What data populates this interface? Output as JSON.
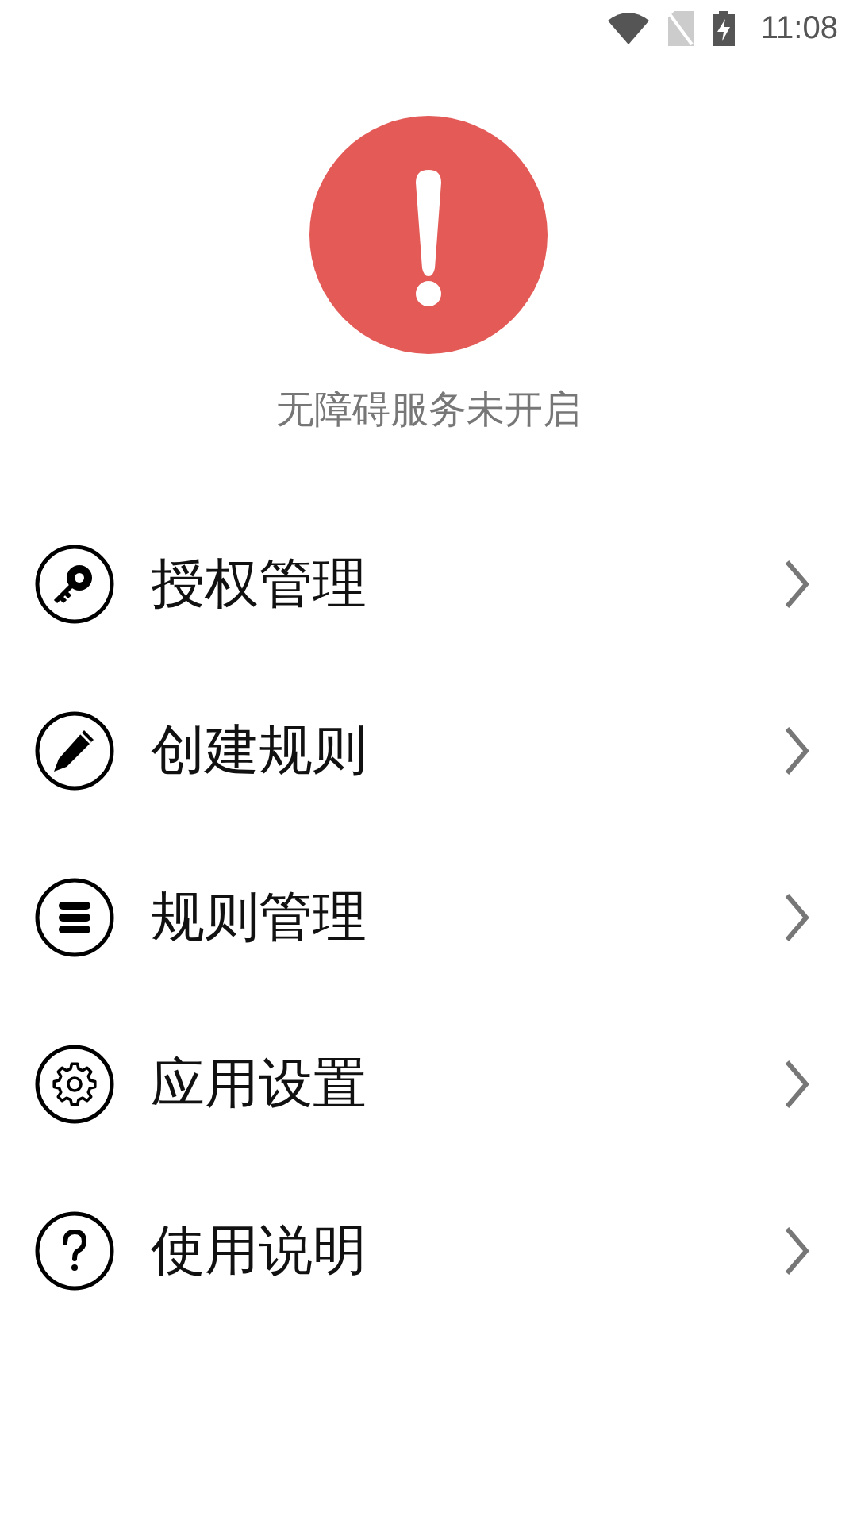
{
  "status_bar": {
    "time": "11:08"
  },
  "alert": {
    "message": "无障碍服务未开启"
  },
  "menu": [
    {
      "kind": "key",
      "label": "授权管理"
    },
    {
      "kind": "pencil",
      "label": "创建规则"
    },
    {
      "kind": "database",
      "label": "规则管理"
    },
    {
      "kind": "gear",
      "label": "应用设置"
    },
    {
      "kind": "help",
      "label": "使用说明"
    }
  ]
}
